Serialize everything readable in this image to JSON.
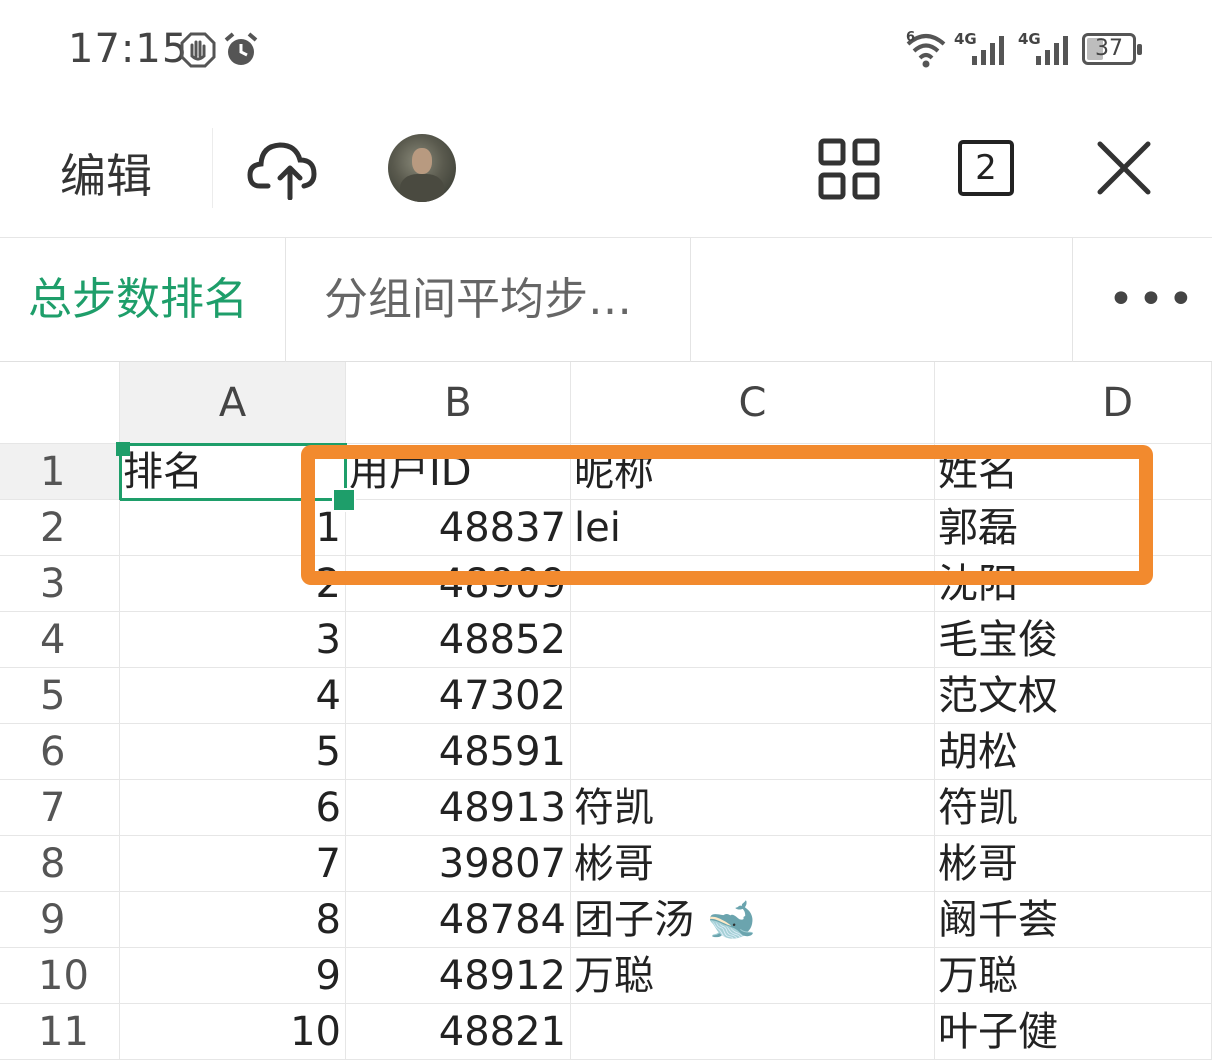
{
  "status_bar": {
    "time": "17:15",
    "wifi_label": "6",
    "signal1_label": "4G",
    "signal2_label": "4G",
    "battery": "37",
    "battery_level": 0.37
  },
  "toolbar": {
    "edit_label": "编辑",
    "tab_count": "2"
  },
  "sheet_tabs": [
    {
      "label": "总步数排名",
      "active": true
    },
    {
      "label": "分组间平均步…",
      "active": false
    }
  ],
  "more_label": "•••",
  "columns": [
    "A",
    "B",
    "C",
    "D"
  ],
  "rows": [
    {
      "num": "1",
      "a": "排名",
      "b": "用户ID",
      "c": "昵称",
      "d": "姓名"
    },
    {
      "num": "2",
      "a": "1",
      "b": "48837",
      "c": "lei",
      "d": "郭磊"
    },
    {
      "num": "3",
      "a": "2",
      "b": "48909",
      "c": "",
      "d": "沈阳"
    },
    {
      "num": "4",
      "a": "3",
      "b": "48852",
      "c": "",
      "d": "毛宝俊"
    },
    {
      "num": "5",
      "a": "4",
      "b": "47302",
      "c": "",
      "d": "范文权"
    },
    {
      "num": "6",
      "a": "5",
      "b": "48591",
      "c": "",
      "d": "胡松"
    },
    {
      "num": "7",
      "a": "6",
      "b": "48913",
      "c": "符凯",
      "d": "符凯"
    },
    {
      "num": "8",
      "a": "7",
      "b": "39807",
      "c": "彬哥",
      "d": "彬哥"
    },
    {
      "num": "9",
      "a": "8",
      "b": "48784",
      "c": "团子汤 🐋",
      "d": "阚千荟"
    },
    {
      "num": "10",
      "a": "9",
      "b": "48912",
      "c": "万聪",
      "d": "万聪"
    },
    {
      "num": "11",
      "a": "10",
      "b": "48821",
      "c": "",
      "d": "叶子健"
    }
  ],
  "colors": {
    "accent": "#1e9e6a",
    "annotation": "#f28a2e"
  }
}
